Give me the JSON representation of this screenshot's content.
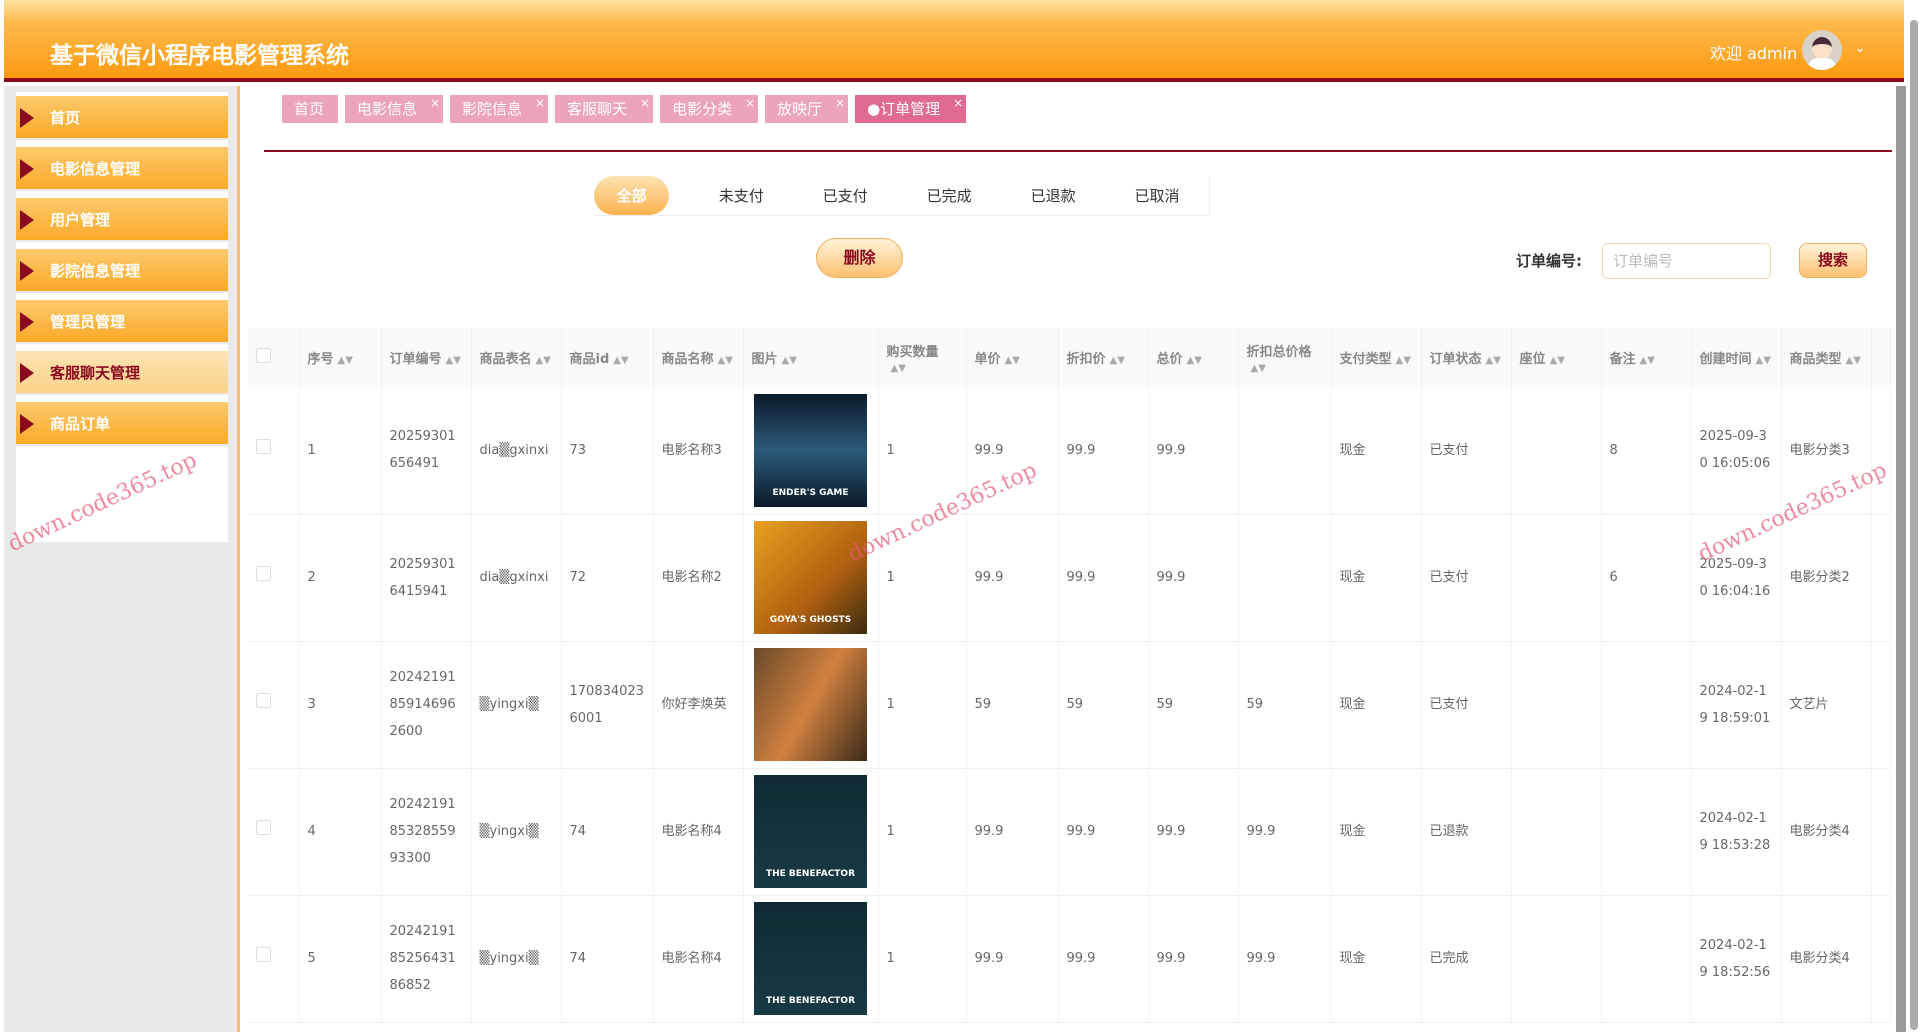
{
  "header": {
    "title": "基于微信小程序电影管理系统",
    "welcome": "欢迎 admin"
  },
  "sidebar": {
    "items": [
      {
        "label": "首页"
      },
      {
        "label": "电影信息管理"
      },
      {
        "label": "用户管理"
      },
      {
        "label": "影院信息管理"
      },
      {
        "label": "管理员管理"
      },
      {
        "label": "客服聊天管理",
        "active": true
      },
      {
        "label": "商品订单"
      }
    ]
  },
  "tabs": [
    {
      "label": "首页"
    },
    {
      "label": "电影信息"
    },
    {
      "label": "影院信息"
    },
    {
      "label": "客服聊天"
    },
    {
      "label": "电影分类"
    },
    {
      "label": "放映厅"
    },
    {
      "label": "●订单管理",
      "active": true
    }
  ],
  "status_tabs": [
    "全部",
    "未支付",
    "已支付",
    "已完成",
    "已退款",
    "已取消"
  ],
  "toolbar": {
    "delete_label": "删除",
    "search_label": "订单编号:",
    "search_placeholder": "订单编号",
    "search_button": "搜索"
  },
  "table": {
    "columns": [
      "序号",
      "订单编号",
      "商品表名",
      "商品id",
      "商品名称",
      "图片",
      "购买数量",
      "单价",
      "折扣价",
      "总价",
      "折扣总价格",
      "支付类型",
      "订单状态",
      "座位",
      "备注",
      "创建时间",
      "商品类型"
    ],
    "rows": [
      {
        "index": "1",
        "order_no": "20259301656491",
        "table_name": "dia▒gxinxi",
        "goods_id": "73",
        "goods_name": "电影名称3",
        "poster": "ENDER'S GAME",
        "qty": "1",
        "price": "99.9",
        "discount_price": "99.9",
        "total": "99.9",
        "discount_total": "",
        "pay_type": "现金",
        "status": "已支付",
        "seat": "",
        "remark": "8",
        "created": "2025-09-30 16:05:06",
        "goods_type": "电影分类3"
      },
      {
        "index": "2",
        "order_no": "20259301 6415941",
        "table_name": "dia▒gxinxi",
        "goods_id": "72",
        "goods_name": "电影名称2",
        "poster": "GOYA'S GHOSTS",
        "qty": "1",
        "price": "99.9",
        "discount_price": "99.9",
        "total": "99.9",
        "discount_total": "",
        "pay_type": "现金",
        "status": "已支付",
        "seat": "",
        "remark": "6",
        "created": "2025-09-30 16:04:16",
        "goods_type": "电影分类2"
      },
      {
        "index": "3",
        "order_no": "20242191859146962600",
        "table_name": "▒yingxi▒",
        "goods_id": "1708340236001",
        "goods_name": "你好李焕英",
        "poster": "",
        "qty": "1",
        "price": "59",
        "discount_price": "59",
        "total": "59",
        "discount_total": "59",
        "pay_type": "现金",
        "status": "已支付",
        "seat": "",
        "remark": "",
        "created": "2024-02-19 18:59:01",
        "goods_type": "文艺片"
      },
      {
        "index": "4",
        "order_no": "202421918532855993300",
        "table_name": "▒yingxi▒",
        "goods_id": "74",
        "goods_name": "电影名称4",
        "poster": "THE BENEFACTOR",
        "qty": "1",
        "price": "99.9",
        "discount_price": "99.9",
        "total": "99.9",
        "discount_total": "99.9",
        "pay_type": "现金",
        "status": "已退款",
        "seat": "",
        "remark": "",
        "created": "2024-02-19 18:53:28",
        "goods_type": "电影分类4"
      },
      {
        "index": "5",
        "order_no": "202421918525643186852",
        "table_name": "▒yingxi▒",
        "goods_id": "74",
        "goods_name": "电影名称4",
        "poster": "THE BENEFACTOR",
        "qty": "1",
        "price": "99.9",
        "discount_price": "99.9",
        "total": "99.9",
        "discount_total": "99.9",
        "pay_type": "现金",
        "status": "已完成",
        "seat": "",
        "remark": "",
        "created": "2024-02-19 18:52:56",
        "goods_type": "电影分类4"
      }
    ]
  },
  "watermark": "down.code365.top",
  "colors": {
    "accent": "#fca928",
    "brand_dark": "#8b0a1f",
    "tab_pink": "#eba4bb"
  }
}
